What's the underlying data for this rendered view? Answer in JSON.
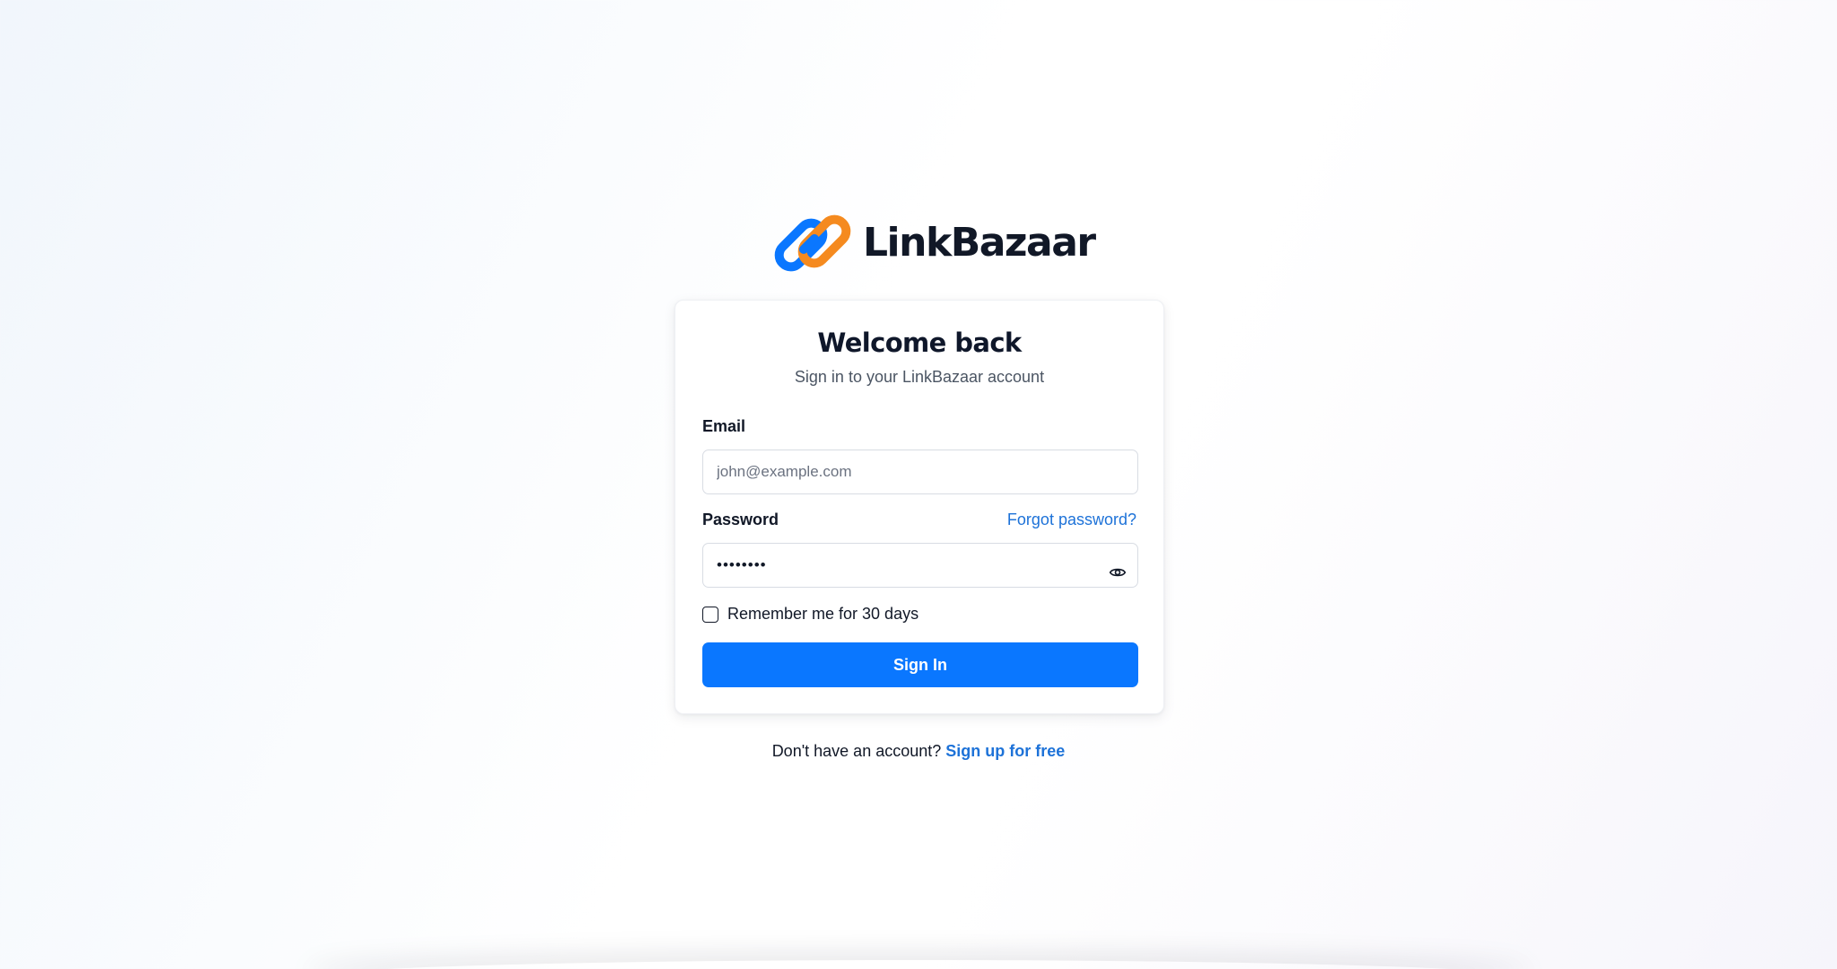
{
  "brand": {
    "name": "LinkBazaar",
    "colors": {
      "link_blue": "#0a77ff",
      "link_orange": "#f58a1f"
    }
  },
  "login": {
    "title": "Welcome back",
    "subtitle": "Sign in to your LinkBazaar account",
    "email": {
      "label": "Email",
      "placeholder": "john@example.com",
      "value": ""
    },
    "password": {
      "label": "Password",
      "value": "••••••••",
      "forgot_label": "Forgot password?",
      "toggle_icon": "eye-icon"
    },
    "remember": {
      "label": "Remember me for 30 days",
      "checked": false
    },
    "submit_label": "Sign In"
  },
  "signup": {
    "prompt": "Don't have an account?",
    "link_label": "Sign up for free"
  },
  "colors": {
    "primary": "#0a77ff",
    "link": "#1d72d8",
    "text": "#0f172a"
  }
}
